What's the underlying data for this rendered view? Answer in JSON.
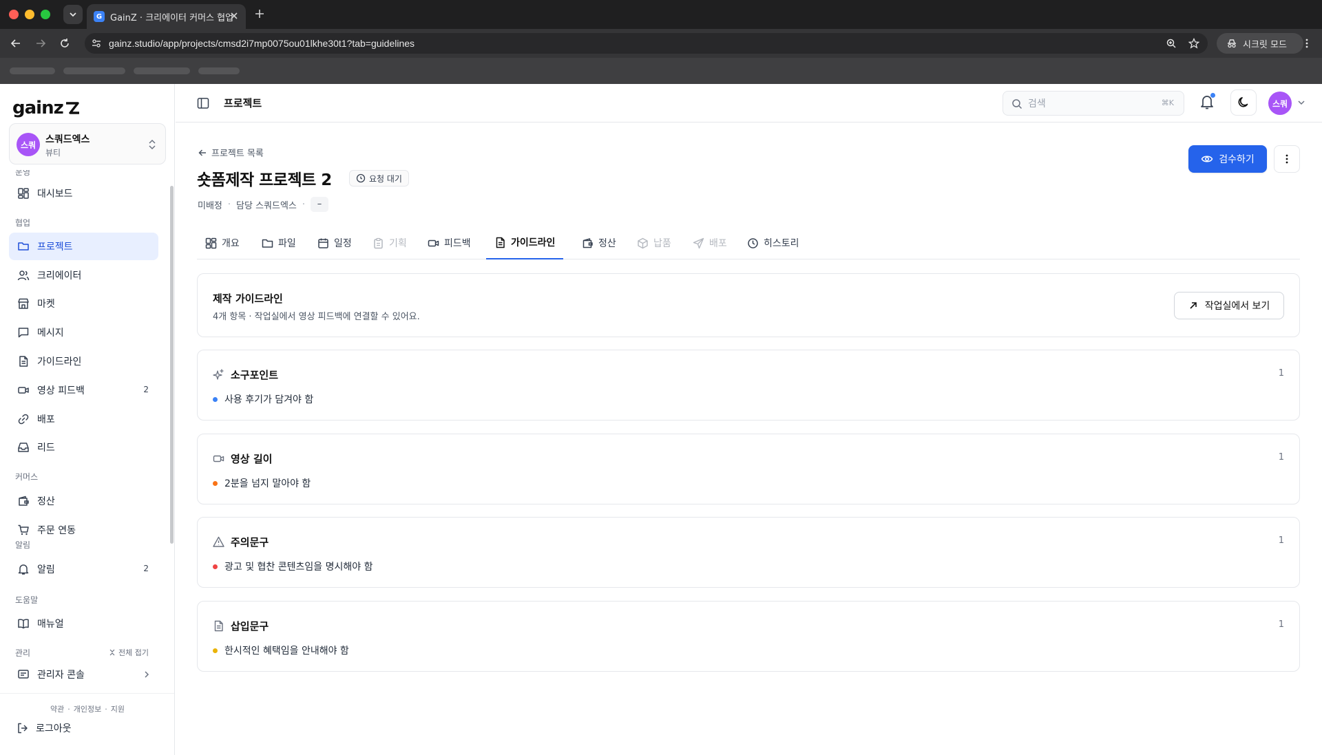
{
  "browser": {
    "tab_title": "GainZ · 크리에이터 커머스 협업 C",
    "favicon_letter": "G",
    "url": "gainz.studio/app/projects/cmsd2i7mp0075ou01lkhe30t1?tab=guidelines",
    "incognito_label": "시크릿 모드"
  },
  "sidebar": {
    "logo": "gainz",
    "workspace": {
      "avatar": "스쿼",
      "name": "스쿼드엑스",
      "category": "뷰티"
    },
    "partial_label": "운영",
    "items": [
      {
        "label": "대시보드",
        "icon": "dashboard-icon"
      },
      {
        "label": "프로젝트",
        "icon": "folder-icon",
        "active": true
      },
      {
        "label": "크리에이터",
        "icon": "users-icon"
      },
      {
        "label": "마켓",
        "icon": "store-icon"
      },
      {
        "label": "메시지",
        "icon": "message-icon"
      },
      {
        "label": "가이드라인",
        "icon": "document-icon"
      },
      {
        "label": "영상 피드백",
        "icon": "video-icon",
        "badge": "2"
      },
      {
        "label": "배포",
        "icon": "link-icon"
      },
      {
        "label": "리드",
        "icon": "inbox-icon"
      },
      {
        "label": "정산",
        "icon": "wallet-icon"
      },
      {
        "label": "주문 연동",
        "icon": "cart-icon"
      },
      {
        "label": "알림",
        "icon": "bell-icon",
        "badge": "2"
      },
      {
        "label": "매뉴얼",
        "icon": "book-icon"
      },
      {
        "label": "관리자 콘솔",
        "icon": "admin-icon"
      }
    ],
    "sections": {
      "collab": "협업",
      "commerce": "커머스",
      "notifications": "알림",
      "help": "도움말",
      "admin": "관리"
    },
    "collapse_all": "전체 접기",
    "footer": {
      "terms": "약관",
      "privacy": "개인정보",
      "support": "지원",
      "logout": "로그아웃"
    }
  },
  "topbar": {
    "title": "프로젝트",
    "search_placeholder": "검색",
    "search_shortcut": "⌘K",
    "user_avatar": "스쿼"
  },
  "project": {
    "back_label": "프로젝트 목록",
    "title": "숏폼제작 프로젝트 2",
    "status": "요청 대기",
    "meta_assign": "미배정",
    "meta_manager": "담당 스쿼드엑스",
    "meta_dash": "–",
    "review_button": "검수하기"
  },
  "tabs": [
    {
      "label": "개요",
      "icon": "grid-icon",
      "state": "normal"
    },
    {
      "label": "파일",
      "icon": "folder-icon",
      "state": "normal"
    },
    {
      "label": "일정",
      "icon": "calendar-icon",
      "state": "normal"
    },
    {
      "label": "기획",
      "icon": "clipboard-icon",
      "state": "disabled"
    },
    {
      "label": "피드백",
      "icon": "video-icon",
      "state": "normal"
    },
    {
      "label": "가이드라인",
      "icon": "document-icon",
      "state": "active"
    },
    {
      "label": "정산",
      "icon": "wallet-icon",
      "state": "normal"
    },
    {
      "label": "납품",
      "icon": "package-icon",
      "state": "disabled"
    },
    {
      "label": "배포",
      "icon": "send-icon",
      "state": "disabled"
    },
    {
      "label": "히스토리",
      "icon": "clock-icon",
      "state": "normal"
    }
  ],
  "guidelines": {
    "title": "제작 가이드라인",
    "description": "4개 항목 · 작업실에서 영상 피드백에 연결할 수 있어요.",
    "studio_button": "작업실에서 보기",
    "sections": [
      {
        "title": "소구포인트",
        "icon": "sparkles-icon",
        "count": "1",
        "item": "사용 후기가 담겨야 함",
        "dot_color": "#3b82f6"
      },
      {
        "title": "영상 길이",
        "icon": "video-icon",
        "count": "1",
        "item": "2분을 넘지 말아야 함",
        "dot_color": "#f97316"
      },
      {
        "title": "주의문구",
        "icon": "warning-icon",
        "count": "1",
        "item": "광고 및 협찬 콘텐츠임을 명시해야 함",
        "dot_color": "#ef4444"
      },
      {
        "title": "삽입문구",
        "icon": "document-icon",
        "count": "1",
        "item": "한시적인 혜택임을 안내해야 함",
        "dot_color": "#eab308"
      }
    ]
  },
  "colors": {
    "accent": "#2563eb",
    "active_nav_bg": "#e8efff",
    "avatar": "#a855f7"
  }
}
